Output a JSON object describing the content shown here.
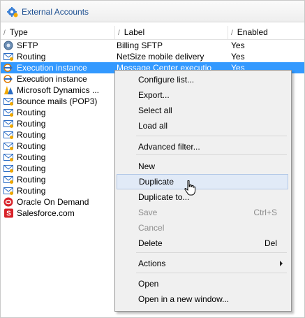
{
  "window": {
    "title": "External Accounts"
  },
  "columns": {
    "type": "Type",
    "label": "Label",
    "enabled": "Enabled"
  },
  "rows": [
    {
      "icon": "sftp-icon",
      "type": "SFTP",
      "label": "Billing SFTP",
      "enabled": "Yes"
    },
    {
      "icon": "routing-icon",
      "type": "Routing",
      "label": "NetSize mobile delivery",
      "enabled": "Yes"
    },
    {
      "icon": "execution-instance-icon",
      "type": "Execution instance",
      "label": "Message Center executio",
      "enabled": "Yes",
      "selected": true
    },
    {
      "icon": "execution-instance-icon",
      "type": "Execution instance",
      "label": "",
      "enabled": ""
    },
    {
      "icon": "microsoft-dynamics-icon",
      "type": "Microsoft Dynamics ...",
      "label": "",
      "enabled": ""
    },
    {
      "icon": "routing-icon",
      "type": "Bounce mails (POP3)",
      "label": "",
      "enabled": ""
    },
    {
      "icon": "routing-icon",
      "type": "Routing",
      "label": "",
      "enabled": ""
    },
    {
      "icon": "routing-icon",
      "type": "Routing",
      "label": "",
      "enabled": ""
    },
    {
      "icon": "routing-icon",
      "type": "Routing",
      "label": "",
      "enabled": ""
    },
    {
      "icon": "routing-icon",
      "type": "Routing",
      "label": "",
      "enabled": ""
    },
    {
      "icon": "routing-icon",
      "type": "Routing",
      "label": "",
      "enabled": ""
    },
    {
      "icon": "routing-icon",
      "type": "Routing",
      "label": "",
      "enabled": ""
    },
    {
      "icon": "routing-icon",
      "type": "Routing",
      "label": "",
      "enabled": ""
    },
    {
      "icon": "routing-icon",
      "type": "Routing",
      "label": "",
      "enabled": ""
    },
    {
      "icon": "oracle-icon",
      "type": "Oracle On Demand",
      "label": "",
      "enabled": ""
    },
    {
      "icon": "salesforce-icon",
      "type": "Salesforce.com",
      "label": "",
      "enabled": ""
    }
  ],
  "context_menu": {
    "items": [
      {
        "label": "Configure list...",
        "shortcut": ""
      },
      {
        "label": "Export...",
        "shortcut": ""
      },
      {
        "label": "Select all",
        "shortcut": ""
      },
      {
        "label": "Load all",
        "shortcut": ""
      },
      {
        "label": "Advanced filter...",
        "shortcut": ""
      },
      {
        "label": "New",
        "shortcut": ""
      },
      {
        "label": "Duplicate",
        "shortcut": "",
        "hover": true
      },
      {
        "label": "Duplicate to...",
        "shortcut": ""
      },
      {
        "label": "Save",
        "shortcut": "Ctrl+S",
        "disabled": true
      },
      {
        "label": "Cancel",
        "shortcut": "",
        "disabled": true
      },
      {
        "label": "Delete",
        "shortcut": "Del"
      },
      {
        "label": "Actions",
        "shortcut": "",
        "submenu": true
      },
      {
        "label": "Open",
        "shortcut": ""
      },
      {
        "label": "Open in a new window...",
        "shortcut": ""
      }
    ]
  },
  "colors": {
    "selection": "#3399ff",
    "title_text": "#1d4f91",
    "menu_bg": "#f0f0f0"
  }
}
